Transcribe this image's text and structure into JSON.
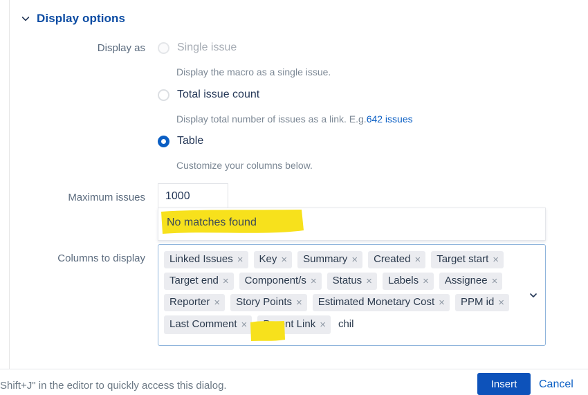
{
  "section": {
    "title": "Display options",
    "toggle_icon": "chevron-down-icon"
  },
  "fields": {
    "display_as_label": "Display as",
    "maximum_issues_label": "Maximum issues",
    "columns_to_display_label": "Columns to display"
  },
  "display_as": {
    "options": [
      {
        "label": "Single issue",
        "help": "Display the macro as a single issue.",
        "state": "disabled"
      },
      {
        "label": "Total issue count",
        "help_prefix": "Display total number of issues as a link. E.g.",
        "help_link": "642 issues",
        "state": "unchecked"
      },
      {
        "label": "Table",
        "help": "Customize your columns below.",
        "state": "checked"
      }
    ]
  },
  "maximum_issues": {
    "value": "1000",
    "placeholder": ""
  },
  "dropdown": {
    "empty_message": "No matches found"
  },
  "columns_to_display": {
    "typed_text": "chil",
    "placeholder": "",
    "expand_icon": "chevron-down-icon",
    "remove_icon": "×",
    "tags": [
      "Linked Issues",
      "Key",
      "Summary",
      "Created",
      "Target start",
      "Target end",
      "Component/s",
      "Status",
      "Labels",
      "Assignee",
      "Reporter",
      "Story Points",
      "Estimated Monetary Cost",
      "PPM id",
      "Last Comment",
      "Parent Link"
    ]
  },
  "footer": {
    "hint": "Shift+J\" in the editor to quickly access this dialog.",
    "insert_label": "Insert",
    "cancel_label": "Cancel"
  },
  "colors": {
    "accent": "#0b5fc4",
    "primary_button": "#0d52ba",
    "heading": "#0c4ca3",
    "highlighter": "#f7e11c",
    "tag_background": "#ebecf0",
    "label_text": "#5b6b7e"
  }
}
